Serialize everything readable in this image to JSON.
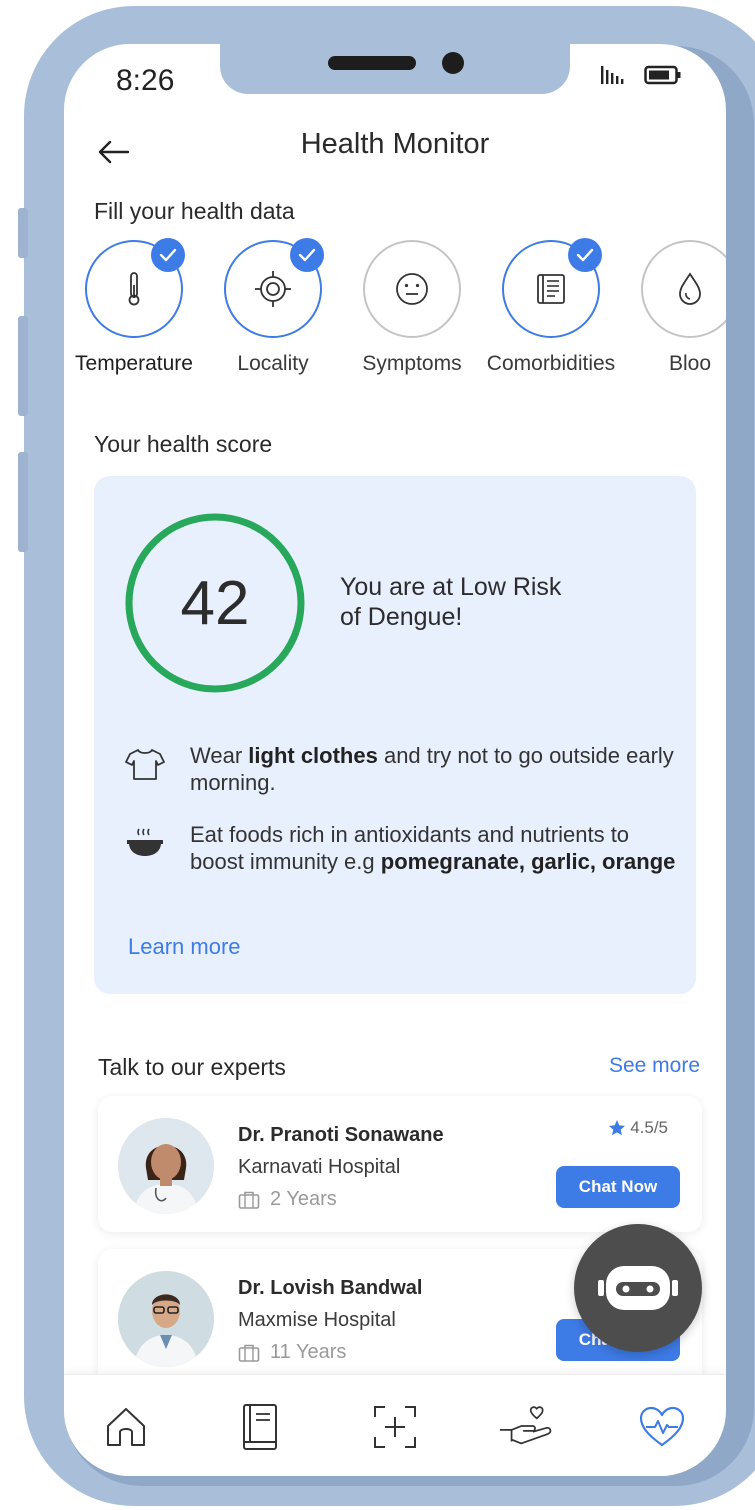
{
  "status_bar": {
    "time": "8:26"
  },
  "header": {
    "title": "Health Monitor"
  },
  "health_data": {
    "section_label": "Fill your health data",
    "items": [
      {
        "label": "Temperature",
        "icon": "thermometer-icon",
        "checked": true
      },
      {
        "label": "Locality",
        "icon": "crosshair-icon",
        "checked": true
      },
      {
        "label": "Symptoms",
        "icon": "neutral-face-icon",
        "checked": false
      },
      {
        "label": "Comorbidities",
        "icon": "document-icon",
        "checked": true
      },
      {
        "label": "Bloo",
        "icon": "blood-drop-icon",
        "checked": false
      }
    ]
  },
  "health_score": {
    "section_label": "Your health score",
    "score": "42",
    "risk_line1": "You are at Low Risk",
    "risk_line2": "of Dengue!",
    "tip1": {
      "prefix": "Wear ",
      "bold": "light clothes",
      "suffix": " and try not to go outside early morning.",
      "icon": "tshirt-icon"
    },
    "tip2": {
      "prefix": "Eat foods rich in antioxidants and nutrients  to boost immunity e.g ",
      "bold": "pomegranate, garlic, orange",
      "icon": "food-bowl-icon"
    },
    "learn_more": "Learn more",
    "ring_color": "#27a85a"
  },
  "experts": {
    "section_label": "Talk to our experts",
    "see_more": "See more",
    "list": [
      {
        "name": "Dr. Pranoti Sonawane",
        "hospital": "Karnavati Hospital",
        "experience": "2 Years",
        "rating": "4.5/5",
        "chat_label": "Chat Now"
      },
      {
        "name": "Dr. Lovish Bandwal",
        "hospital": "Maxmise Hospital",
        "experience": "11 Years",
        "rating": "",
        "chat_label": "Chat Now"
      }
    ]
  },
  "bottom_nav": [
    {
      "icon": "home-icon",
      "active": false
    },
    {
      "icon": "book-icon",
      "active": false
    },
    {
      "icon": "scan-add-icon",
      "active": false
    },
    {
      "icon": "care-hand-icon",
      "active": false
    },
    {
      "icon": "heart-pulse-icon",
      "active": true
    }
  ],
  "colors": {
    "accent": "#3d7be6",
    "score_ring": "#27a85a",
    "card_bg": "#e8effd",
    "frame": "#a9bfd9"
  }
}
